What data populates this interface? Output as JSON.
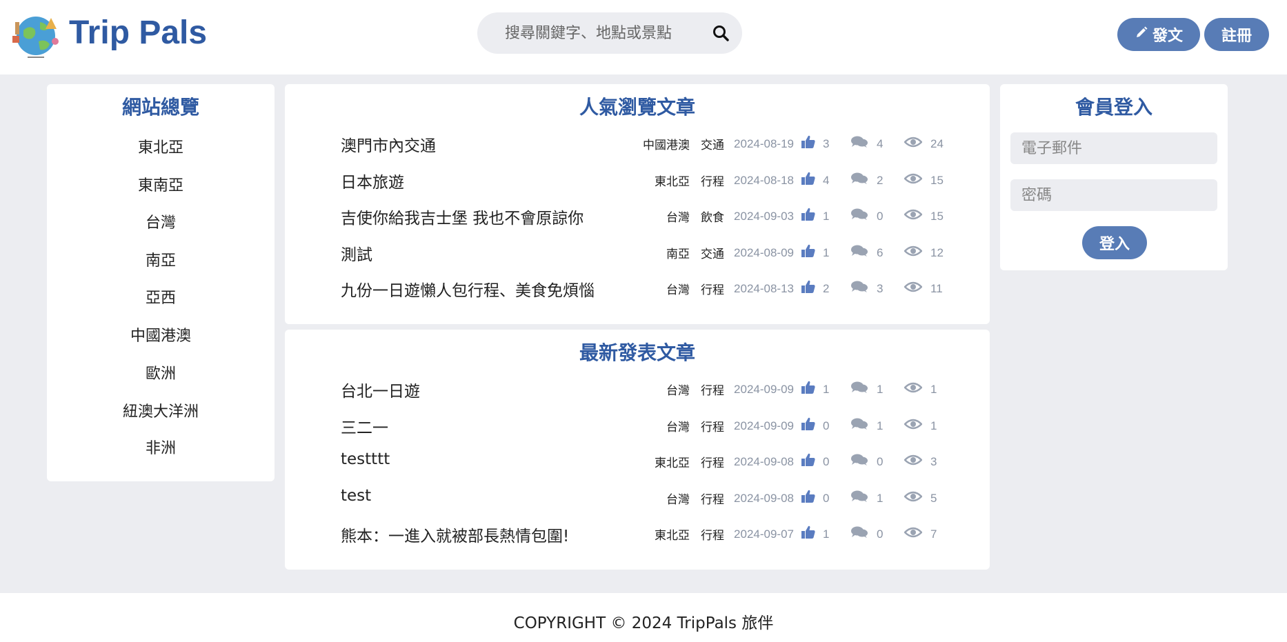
{
  "header": {
    "brand": "Trip Pals",
    "search_placeholder": "搜尋關鍵字、地點或景點",
    "post_label": "發文",
    "register_label": "註冊"
  },
  "sidebar": {
    "title": "網站總覽",
    "regions": [
      "東北亞",
      "東南亞",
      "台灣",
      "南亞",
      "亞西",
      "中國港澳",
      "歐洲",
      "紐澳大洋洲",
      "非洲"
    ]
  },
  "popular": {
    "title": "人氣瀏覽文章",
    "articles": [
      {
        "title": "澳門市內交通",
        "region": "中國港澳",
        "category": "交通",
        "date": "2024-08-19",
        "likes": "3",
        "comments": "4",
        "views": "24"
      },
      {
        "title": "日本旅遊",
        "region": "東北亞",
        "category": "行程",
        "date": "2024-08-18",
        "likes": "4",
        "comments": "2",
        "views": "15"
      },
      {
        "title": "吉使你給我吉士堡 我也不會原諒你",
        "region": "台灣",
        "category": "飲食",
        "date": "2024-09-03",
        "likes": "1",
        "comments": "0",
        "views": "15"
      },
      {
        "title": "測試",
        "region": "南亞",
        "category": "交通",
        "date": "2024-08-09",
        "likes": "1",
        "comments": "6",
        "views": "12"
      },
      {
        "title": "九份一日遊懶人包行程、美食免煩惱",
        "region": "台灣",
        "category": "行程",
        "date": "2024-08-13",
        "likes": "2",
        "comments": "3",
        "views": "11"
      }
    ]
  },
  "latest": {
    "title": "最新發表文章",
    "articles": [
      {
        "title": "台北一日遊",
        "region": "台灣",
        "category": "行程",
        "date": "2024-09-09",
        "likes": "1",
        "comments": "1",
        "views": "1"
      },
      {
        "title": "三二一",
        "region": "台灣",
        "category": "行程",
        "date": "2024-09-09",
        "likes": "0",
        "comments": "1",
        "views": "1"
      },
      {
        "title": "testttt",
        "region": "東北亞",
        "category": "行程",
        "date": "2024-09-08",
        "likes": "0",
        "comments": "0",
        "views": "3"
      },
      {
        "title": "test",
        "region": "台灣",
        "category": "行程",
        "date": "2024-09-08",
        "likes": "0",
        "comments": "1",
        "views": "5"
      },
      {
        "title": "熊本：一進入就被部長熱情包圍!",
        "region": "東北亞",
        "category": "行程",
        "date": "2024-09-07",
        "likes": "1",
        "comments": "0",
        "views": "7"
      }
    ]
  },
  "login": {
    "title": "會員登入",
    "email_placeholder": "電子郵件",
    "password_placeholder": "密碼",
    "submit_label": "登入"
  },
  "footer": {
    "copyright": "COPYRIGHT © 2024 TripPals 旅伴"
  },
  "colors": {
    "accent": "#2f5aa2",
    "button": "#587cb6",
    "background": "#ecedf1",
    "muted": "#8a93a3"
  },
  "icons": {
    "logo": "globe-travel-logo",
    "search": "search-icon",
    "post": "pencil-icon",
    "like": "thumbs-up-icon",
    "comment": "comments-icon",
    "view": "eye-icon"
  }
}
